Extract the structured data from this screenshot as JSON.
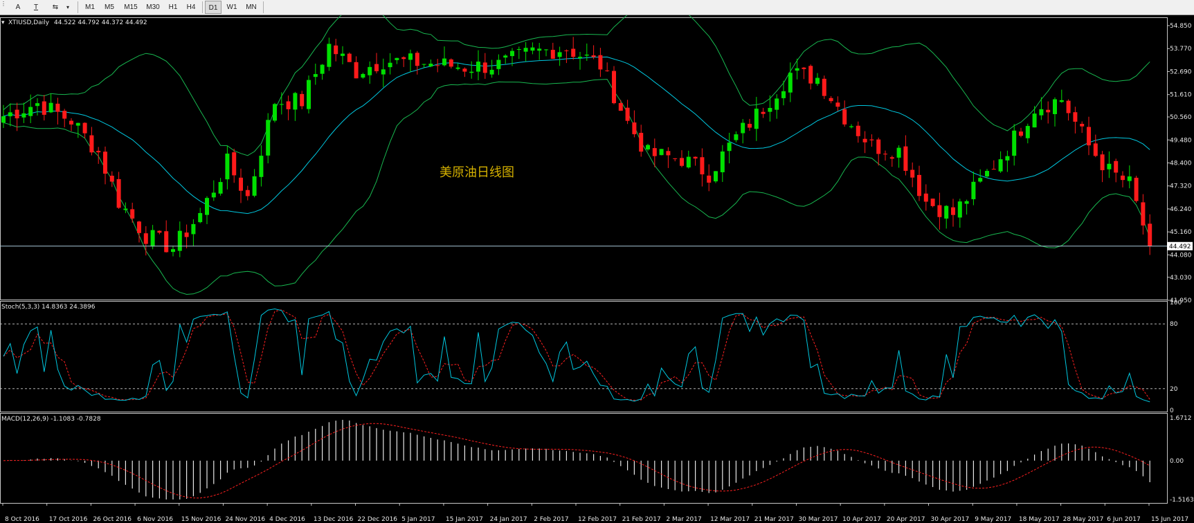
{
  "toolbar": {
    "tools": [
      {
        "name": "text-tool",
        "glyph": "A"
      },
      {
        "name": "text-label-tool",
        "glyph": "T"
      },
      {
        "name": "arrows-tool",
        "glyph": "⇆"
      }
    ],
    "timeframes": [
      {
        "label": "M1",
        "active": false
      },
      {
        "label": "M5",
        "active": false
      },
      {
        "label": "M15",
        "active": false
      },
      {
        "label": "M30",
        "active": false
      },
      {
        "label": "H1",
        "active": false
      },
      {
        "label": "H4",
        "active": false
      },
      {
        "label": "D1",
        "active": true
      },
      {
        "label": "W1",
        "active": false
      },
      {
        "label": "MN",
        "active": false
      }
    ]
  },
  "main": {
    "symbol_header": "XTIUSD,Daily",
    "ohlc": "44.522 44.792 44.372 44.492",
    "annotation": "美原油日线图",
    "price_ticks": [
      "54.850",
      "53.770",
      "52.690",
      "51.610",
      "50.560",
      "49.480",
      "48.400",
      "47.320",
      "46.240",
      "45.160",
      "44.080",
      "43.030",
      "41.950"
    ],
    "current_price": "44.492",
    "colors": {
      "bull": "#00e000",
      "bear": "#ff1a1a",
      "ma": "#00c8e0",
      "bands": "#18b850",
      "price_line": "#a8c8d8"
    }
  },
  "stoch": {
    "label": "Stoch(5,3,3) 14.8363 24.3896",
    "ticks": [
      "100",
      "80",
      "20",
      "0"
    ]
  },
  "macd": {
    "label": "MACD(12,26,9) -1.1083 -0.7828",
    "ticks": [
      "1.6712",
      "0.00",
      "-1.5163"
    ]
  },
  "xaxis": {
    "dates": [
      "8 Oct 2016",
      "17 Oct 2016",
      "26 Oct 2016",
      "6 Nov 2016",
      "15 Nov 2016",
      "24 Nov 2016",
      "4 Dec 2016",
      "13 Dec 2016",
      "22 Dec 2016",
      "5 Jan 2017",
      "15 Jan 2017",
      "24 Jan 2017",
      "2 Feb 2017",
      "12 Feb 2017",
      "21 Feb 2017",
      "2 Mar 2017",
      "12 Mar 2017",
      "21 Mar 2017",
      "30 Mar 2017",
      "10 Apr 2017",
      "20 Apr 2017",
      "30 Apr 2017",
      "9 May 2017",
      "18 May 2017",
      "28 May 2017",
      "6 Jun 2017",
      "15 Jun 2017"
    ]
  }
}
